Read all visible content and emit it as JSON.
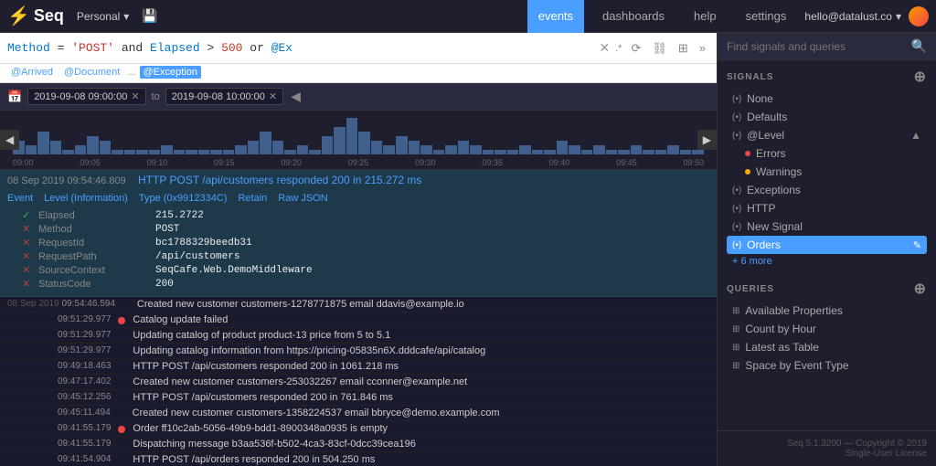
{
  "topnav": {
    "logo": "Seq",
    "personal_label": "Personal",
    "save_icon": "💾",
    "links": [
      {
        "id": "events",
        "label": "events",
        "active": true
      },
      {
        "id": "dashboards",
        "label": "dashboards",
        "active": false
      },
      {
        "id": "help",
        "label": "help",
        "active": false
      },
      {
        "id": "settings",
        "label": "settings",
        "active": false
      },
      {
        "id": "user",
        "label": "hello@datalust.co",
        "active": false
      }
    ]
  },
  "query_bar": {
    "query_text": "Method = 'POST' and Elapsed > 500 or @Ex",
    "query_parts": [
      {
        "type": "keyword",
        "text": "Method"
      },
      {
        "type": "operator",
        "text": " = "
      },
      {
        "type": "value",
        "text": "'POST'"
      },
      {
        "type": "operator",
        "text": " and "
      },
      {
        "type": "keyword",
        "text": "Elapsed"
      },
      {
        "type": "operator",
        "text": " > "
      },
      {
        "type": "value",
        "text": "500"
      },
      {
        "type": "operator",
        "text": " or "
      },
      {
        "type": "keyword",
        "text": "@Ex"
      }
    ]
  },
  "tags": [
    {
      "id": "arrived",
      "label": "@Arrived",
      "active": false
    },
    {
      "id": "document",
      "label": "@Document",
      "active": false
    },
    {
      "id": "more",
      "label": "...",
      "active": false
    },
    {
      "id": "exception",
      "label": "@Exception",
      "active": true
    }
  ],
  "time_range": {
    "from": "2019-09-08 09:00:00",
    "to": "2019-09-08 10:00:00"
  },
  "chart": {
    "bars": [
      3,
      2,
      5,
      3,
      1,
      2,
      4,
      3,
      1,
      1,
      1,
      1,
      2,
      1,
      1,
      1,
      1,
      1,
      2,
      3,
      5,
      3,
      1,
      2,
      1,
      4,
      6,
      8,
      5,
      3,
      2,
      4,
      3,
      2,
      1,
      2,
      3,
      2,
      1,
      1,
      1,
      2,
      1,
      1,
      3,
      2,
      1,
      2,
      1,
      1,
      2,
      1,
      1,
      2,
      1,
      1
    ],
    "labels": [
      "09:00",
      "09:05",
      "09:10",
      "09:15",
      "09:20",
      "09:25",
      "09:30",
      "09:35",
      "09:40",
      "09:45",
      "09:50"
    ]
  },
  "expanded_event": {
    "header": "HTTP POST /api/customers responded 200 in 215.272 ms",
    "timestamp": "08 Sep 2019 09:54:46.809",
    "meta": {
      "event_label": "Event",
      "level_label": "Level (Information)",
      "type_label": "Type (0x9912334C)",
      "retain_label": "Retain",
      "raw_json_label": "Raw JSON"
    },
    "fields": [
      {
        "check": true,
        "name": "Elapsed",
        "value": "215.2722"
      },
      {
        "check": false,
        "name": "Method",
        "value": "POST"
      },
      {
        "check": false,
        "name": "RequestId",
        "value": "bc1788329beedb31"
      },
      {
        "check": false,
        "name": "RequestPath",
        "value": "/api/customers"
      },
      {
        "check": false,
        "name": "SourceContext",
        "value": "SeqCafe.Web.DemoMiddleware"
      },
      {
        "check": false,
        "name": "StatusCode",
        "value": "200"
      }
    ]
  },
  "events": [
    {
      "date": "08 Sep 2019",
      "time": "09:54:46.594",
      "message": "Created new customer customers-1278771875 email ddavis@example.io",
      "dot": null
    },
    {
      "date": "",
      "time": "09:51:29.977",
      "message": "Catalog update failed",
      "dot": "red"
    },
    {
      "date": "",
      "time": "09:51:29.977",
      "message": "Updating catalog of product product-13 price from 5 to 5.1",
      "dot": null
    },
    {
      "date": "",
      "time": "09:51:29.977",
      "message": "Updating catalog information from https://pricing-05835n6X.dddcafe/api/catalog",
      "dot": null
    },
    {
      "date": "",
      "time": "09:49:18.463",
      "message": "HTTP POST /api/customers responded 200 in 1061.218 ms",
      "dot": null
    },
    {
      "date": "",
      "time": "09:47:17.402",
      "message": "Created new customer customers-253032267 email cconner@example.net",
      "dot": null
    },
    {
      "date": "",
      "time": "09:45:12.256",
      "message": "HTTP POST /api/customers responded 200 in 761.846 ms",
      "dot": null
    },
    {
      "date": "",
      "time": "09:45:11.494",
      "message": "Created new customer customers-1358224537 email bbryce@demo.example.com",
      "dot": null
    },
    {
      "date": "",
      "time": "09:41:55.179",
      "message": "Order ff10c2ab-5056-49b9-bdd1-8900348a0935 is empty",
      "dot": "red"
    },
    {
      "date": "",
      "time": "09:41:55.179",
      "message": "Dispatching message b3aa536f-b502-4ca3-83cf-0dcc39cea196",
      "dot": null
    },
    {
      "date": "",
      "time": "09:41:54.904",
      "message": "HTTP POST /api/orders responded 200 in 504.250 ms",
      "dot": null
    }
  ],
  "sidebar": {
    "search_placeholder": "Find signals and queries",
    "signals_section": "SIGNALS",
    "queries_section": "QUERIES",
    "signals": [
      {
        "id": "none",
        "label": "None",
        "active": false,
        "type": "signal"
      },
      {
        "id": "defaults",
        "label": "Defaults",
        "active": false,
        "type": "signal"
      },
      {
        "id": "level",
        "label": "@Level",
        "active": false,
        "type": "signal",
        "has_collapse": true
      },
      {
        "id": "errors",
        "label": "Errors",
        "active": false,
        "type": "sub",
        "dot": "red"
      },
      {
        "id": "warnings",
        "label": "Warnings",
        "active": false,
        "type": "sub",
        "dot": "yellow"
      },
      {
        "id": "exceptions",
        "label": "Exceptions",
        "active": false,
        "type": "signal"
      },
      {
        "id": "http",
        "label": "HTTP",
        "active": false,
        "type": "signal"
      },
      {
        "id": "new-signal",
        "label": "New Signal",
        "active": false,
        "type": "signal"
      },
      {
        "id": "orders",
        "label": "Orders",
        "active": true,
        "type": "signal",
        "editable": true
      },
      {
        "id": "more",
        "label": "+ 6 more",
        "active": false,
        "type": "more"
      }
    ],
    "queries": [
      {
        "id": "available-properties",
        "label": "Available Properties"
      },
      {
        "id": "count-by-hour",
        "label": "Count by Hour"
      },
      {
        "id": "latest-as-table",
        "label": "Latest as Table"
      },
      {
        "id": "space-by-event-type",
        "label": "Space by Event Type"
      }
    ],
    "footer": {
      "version": "Seq 5.1.3200 — Copyright © 2019",
      "license": "Single-User License"
    }
  }
}
